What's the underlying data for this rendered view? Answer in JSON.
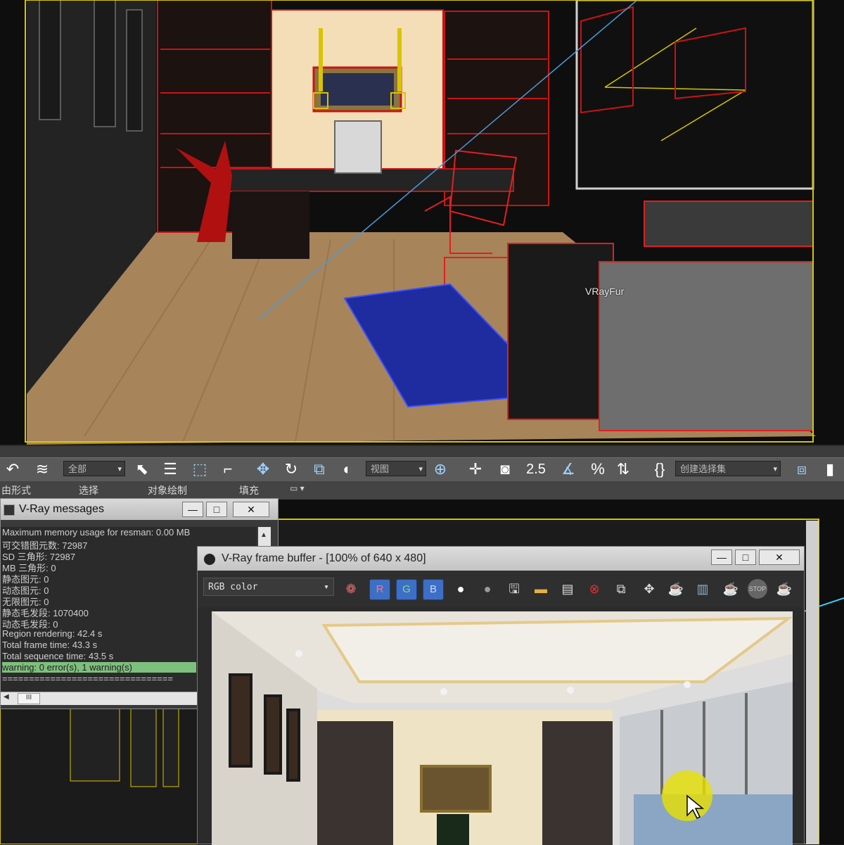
{
  "viewport_top": {
    "object_label": "VRayFur"
  },
  "toolbar": {
    "selection_filter": "全部",
    "reference_coord": "视图",
    "snap_label": "2.5",
    "named_selection": "创建选择集",
    "icons": [
      "undo-icon",
      "wave-icon",
      "select-pointer-icon",
      "select-by-name-icon",
      "rect-region-icon",
      "window-crossing-icon",
      "move-icon",
      "rotate-icon",
      "scale-icon",
      "select-manip-icon",
      "pivot-icon",
      "snap-toggle-icon",
      "angle-snap-icon",
      "percent-snap-icon",
      "spinner-snap-icon",
      "edit-named-sel-icon",
      "mirror-icon",
      "align-icon"
    ]
  },
  "ribbon": {
    "tabs": [
      "由形式",
      "选择",
      "对象绘制",
      "填充"
    ]
  },
  "vray_messages": {
    "title": "V-Ray messages",
    "lines": [
      "Maximum memory usage for resman: 0.00 MB",
      "可交错图元数: 72987",
      " SD 三角形: 72987",
      " MB 三角形: 0",
      " 静态图元: 0",
      " 动态图元: 0",
      " 无限图元: 0",
      " 静态毛发段: 1070400",
      " 动态毛发段: 0",
      "Region rendering: 42.4 s",
      "Total frame time: 43.3 s",
      "Total sequence time: 43.5 s",
      "warning: 0 error(s), 1 warning(s)",
      "================================"
    ],
    "hscroll_label": "III"
  },
  "vray_vfb": {
    "title": "V-Ray frame buffer - [100% of 640 x 480]",
    "channel": "RGB color",
    "channel_buttons": {
      "r": "R",
      "g": "G",
      "b": "B"
    },
    "icons": [
      "color-balls-icon",
      "white-dot-icon",
      "gray-dot-icon",
      "save-icon",
      "open-folder-icon",
      "clipboard-icon",
      "clear-icon",
      "track-mouse-icon",
      "region-icon",
      "teapot-render-icon",
      "histogram-icon",
      "teapot-region-icon",
      "stop-icon",
      "teapot-last-icon"
    ],
    "stop_label": "STOP"
  },
  "colors": {
    "wire_red": "#c81414",
    "selection_yellow": "#d8c400",
    "rug_blue": "#2030c8",
    "floor_wood": "#a8845a",
    "warning_green": "#7dc07d"
  }
}
